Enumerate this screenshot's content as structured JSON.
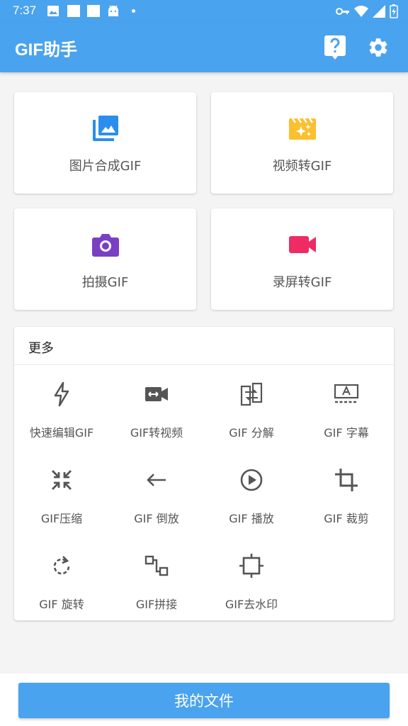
{
  "status_bar": {
    "time": "7:37",
    "left_icons": [
      "image-icon",
      "square-icon",
      "square-icon",
      "android-icon"
    ],
    "right_icons": [
      "vpn-key-icon",
      "wifi-icon",
      "signal-icon",
      "battery-charging-icon"
    ]
  },
  "app_bar": {
    "title": "GIF助手",
    "actions": [
      "help-icon",
      "settings-icon"
    ]
  },
  "features": [
    {
      "label": "图片合成GIF",
      "icon": "photo-library-icon",
      "color": "#2b8eef"
    },
    {
      "label": "视频转GIF",
      "icon": "movie-filter-icon",
      "color": "#fbc02d"
    },
    {
      "label": "拍摄GIF",
      "icon": "camera-icon",
      "color": "#7b3fc4"
    },
    {
      "label": "录屏转GIF",
      "icon": "videocam-icon",
      "color": "#ef2b63"
    }
  ],
  "more": {
    "title": "更多",
    "tools": [
      {
        "label": "快速编辑GIF",
        "icon": "flash-icon"
      },
      {
        "label": "GIF转视频",
        "icon": "video-convert-icon"
      },
      {
        "label": "GIF 分解",
        "icon": "split-icon"
      },
      {
        "label": "GIF 字幕",
        "icon": "subtitle-icon"
      },
      {
        "label": "GIF压缩",
        "icon": "compress-icon"
      },
      {
        "label": "GIF 倒放",
        "icon": "arrow-back-icon"
      },
      {
        "label": "GIF 播放",
        "icon": "play-circle-icon"
      },
      {
        "label": "GIF 裁剪",
        "icon": "crop-icon"
      },
      {
        "label": "GIF 旋转",
        "icon": "rotate-icon"
      },
      {
        "label": "GIF拼接",
        "icon": "join-icon"
      },
      {
        "label": "GIF去水印",
        "icon": "remove-watermark-icon"
      }
    ]
  },
  "bottom": {
    "button_label": "我的文件"
  },
  "colors": {
    "primary": "#4aa3ee",
    "icon_gray": "#555555",
    "background": "#f4f4f4"
  }
}
